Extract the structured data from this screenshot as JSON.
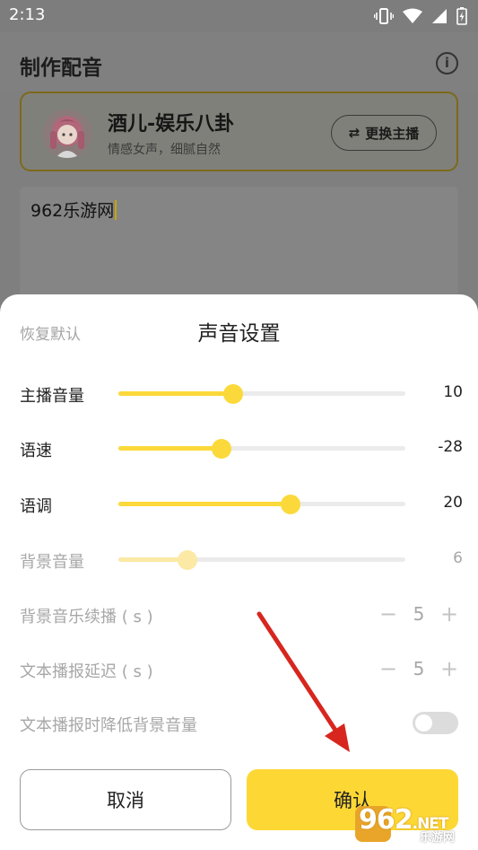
{
  "status_bar": {
    "time": "2:13"
  },
  "header": {
    "title": "制作配音"
  },
  "anchor": {
    "name": "酒儿-娱乐八卦",
    "description": "情感女声，细腻自然",
    "switch_label": "更换主播"
  },
  "editor": {
    "text": "962乐游网"
  },
  "sheet": {
    "reset_label": "恢复默认",
    "title": "声音设置",
    "sliders": [
      {
        "label": "主播音量",
        "value": "10",
        "fraction": 0.4,
        "enabled": true
      },
      {
        "label": "语速",
        "value": "-28",
        "fraction": 0.36,
        "enabled": true
      },
      {
        "label": "语调",
        "value": "20",
        "fraction": 0.6,
        "enabled": true
      },
      {
        "label": "背景音量",
        "value": "6",
        "fraction": 0.24,
        "enabled": false
      }
    ],
    "steppers": [
      {
        "label": "背景音乐续播 ( s )",
        "value": "5",
        "minus": "−",
        "plus": "+"
      },
      {
        "label": "文本播报延迟 ( s )",
        "value": "5",
        "minus": "−",
        "plus": "+"
      }
    ],
    "toggle": {
      "label": "文本播报时降低背景音量",
      "on": false
    },
    "cancel_label": "取消",
    "confirm_label": "确认"
  },
  "watermark": {
    "main": "962",
    "suffix": ".NET",
    "sub": "乐游网"
  },
  "colors": {
    "accent": "#fdd835",
    "overlay": "#7f7f7f",
    "arrow": "#d7261e"
  },
  "icons": [
    "vibrate-icon",
    "wifi-icon",
    "signal-icon",
    "battery-icon",
    "info-icon",
    "swap-icon"
  ]
}
